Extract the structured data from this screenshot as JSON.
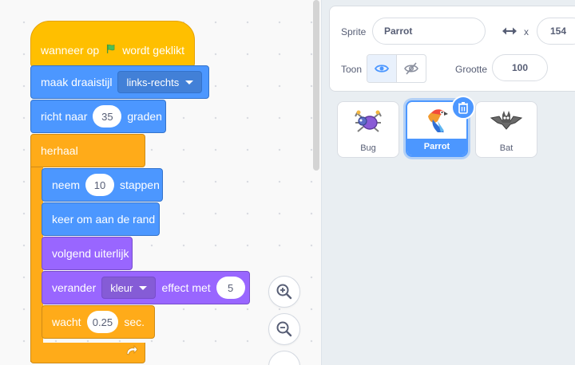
{
  "blocks": {
    "when_flag": {
      "before": "wanneer op",
      "after": "wordt geklikt"
    },
    "rotation_style": {
      "label": "maak draaistijl",
      "value": "links-rechts"
    },
    "point_direction": {
      "before": "richt naar",
      "value": "35",
      "after": "graden"
    },
    "forever": {
      "label": "herhaal"
    },
    "move": {
      "before": "neem",
      "value": "10",
      "after": "stappen"
    },
    "bounce": {
      "label": "keer om aan de rand"
    },
    "next_costume": {
      "label": "volgend uiterlijk"
    },
    "change_effect": {
      "before": "verander",
      "effect": "kleur",
      "middle": "effect met",
      "value": "5"
    },
    "wait": {
      "before": "wacht",
      "value": "0.25",
      "after": "sec."
    }
  },
  "sprite_info": {
    "sprite_label": "Sprite",
    "sprite_name": "Parrot",
    "x_label": "x",
    "x_value": "154",
    "show_label": "Toon",
    "size_label": "Grootte",
    "size_value": "100"
  },
  "sprites": [
    {
      "name": "Bug"
    },
    {
      "name": "Parrot",
      "selected": true
    },
    {
      "name": "Bat"
    }
  ],
  "colors": {
    "events": "#ffbf00",
    "motion": "#4c97ff",
    "looks": "#9966ff",
    "control": "#ffab19",
    "accent": "#4c97ff"
  },
  "icons": [
    "green-flag-icon",
    "dropdown-caret-icon",
    "loop-arrow-icon",
    "zoom-in-icon",
    "zoom-out-icon",
    "arrows-horizontal-icon",
    "eye-icon",
    "eye-slash-icon",
    "trash-icon"
  ]
}
